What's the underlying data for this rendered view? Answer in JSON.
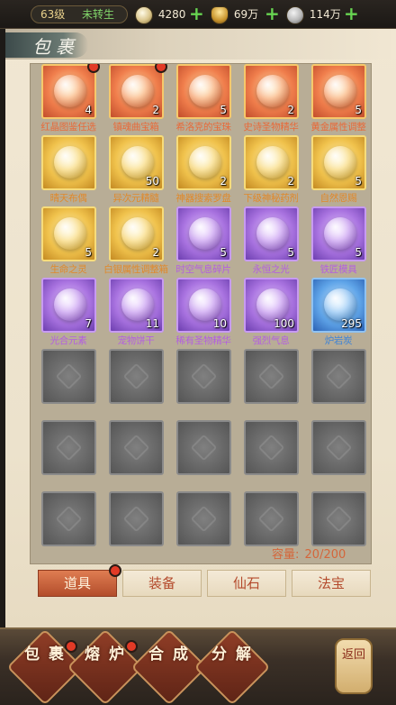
{
  "topbar": {
    "level": "63级",
    "rebirth": "未转生",
    "currencies": [
      {
        "icon": "silver-coin-icon",
        "value": "4280"
      },
      {
        "icon": "gold-ingot-icon",
        "value": "69万"
      },
      {
        "icon": "copper-coin-icon",
        "value": "114万"
      }
    ]
  },
  "panel": {
    "title": "包裹"
  },
  "items": [
    {
      "name": "红晶图鉴任选",
      "count": "4",
      "rarity": "orange",
      "dot": true
    },
    {
      "name": "镇魂曲宝箱",
      "count": "2",
      "rarity": "orange",
      "dot": true
    },
    {
      "name": "希洛克的宝珠",
      "count": "5",
      "rarity": "orange",
      "dot": false
    },
    {
      "name": "史诗圣物精华",
      "count": "2",
      "rarity": "orange",
      "dot": false
    },
    {
      "name": "黄金属性调整",
      "count": "5",
      "rarity": "orange",
      "dot": false
    },
    {
      "name": "晴天布偶",
      "count": "",
      "rarity": "gold",
      "dot": false
    },
    {
      "name": "异次元精髓",
      "count": "50",
      "rarity": "gold",
      "dot": false
    },
    {
      "name": "神器搜索罗盘",
      "count": "2",
      "rarity": "gold",
      "dot": false
    },
    {
      "name": "下级神秘药剂",
      "count": "2",
      "rarity": "gold",
      "dot": false
    },
    {
      "name": "自然恩赐",
      "count": "5",
      "rarity": "gold",
      "dot": false
    },
    {
      "name": "生命之灵",
      "count": "5",
      "rarity": "gold",
      "dot": false
    },
    {
      "name": "白银属性调整箱",
      "count": "2",
      "rarity": "gold",
      "dot": false
    },
    {
      "name": "时空气息碎片",
      "count": "5",
      "rarity": "purple",
      "dot": false
    },
    {
      "name": "永恒之光",
      "count": "5",
      "rarity": "purple",
      "dot": false
    },
    {
      "name": "铁匠模具",
      "count": "5",
      "rarity": "purple",
      "dot": false
    },
    {
      "name": "光合元素",
      "count": "7",
      "rarity": "purple",
      "dot": false
    },
    {
      "name": "宠物饼干",
      "count": "11",
      "rarity": "purple",
      "dot": false
    },
    {
      "name": "稀有圣物精华",
      "count": "10",
      "rarity": "purple",
      "dot": false
    },
    {
      "name": "强烈气息",
      "count": "100",
      "rarity": "purple",
      "dot": false
    },
    {
      "name": "炉岩炭",
      "count": "295",
      "rarity": "blue",
      "dot": false
    }
  ],
  "capacity": {
    "label": "容量:",
    "value": "20/200"
  },
  "tabs": [
    {
      "label": "道具",
      "active": true,
      "dot": true
    },
    {
      "label": "装备",
      "active": false,
      "dot": false
    },
    {
      "label": "仙石",
      "active": false,
      "dot": false
    },
    {
      "label": "法宝",
      "active": false,
      "dot": false
    }
  ],
  "bottom_nav": [
    {
      "label": "包裹",
      "dot": true
    },
    {
      "label": "熔炉",
      "dot": true
    },
    {
      "label": "合成",
      "dot": false
    },
    {
      "label": "分解",
      "dot": false
    }
  ],
  "back_button": "返回",
  "colors": {
    "orange_label": "#e86a3a",
    "gold_label": "#e0892b",
    "purple_label": "#b35fe0",
    "blue_label": "#3f84d6",
    "plus": "#67d451",
    "badge": "#e23a26"
  }
}
